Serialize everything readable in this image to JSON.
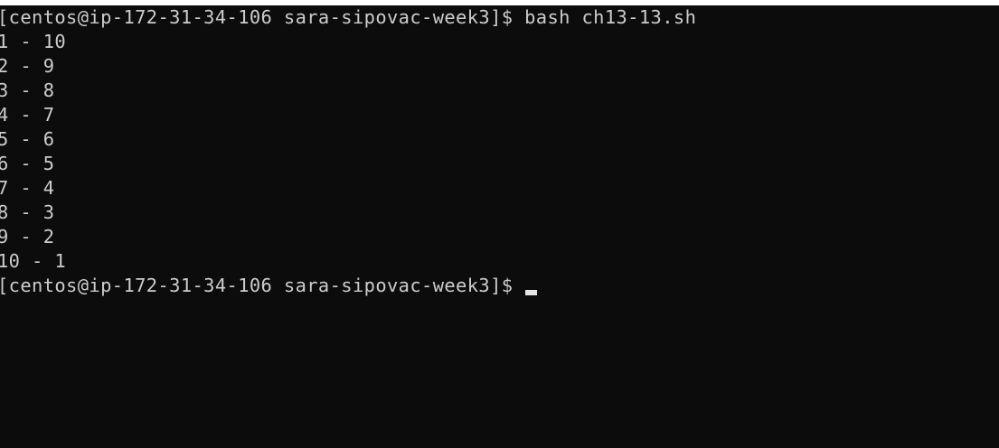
{
  "terminal": {
    "lines": [
      "[centos@ip-172-31-34-106 sara-sipovac-week3]$ bash ch13-13.sh",
      "1 - 10",
      "2 - 9",
      "3 - 8",
      "4 - 7",
      "5 - 6",
      "6 - 5",
      "7 - 4",
      "8 - 3",
      "9 - 2",
      "10 - 1"
    ],
    "prompt": "[centos@ip-172-31-34-106 sara-sipovac-week3]$ ",
    "colors": {
      "background": "#0c0c0c",
      "text": "#cccccc",
      "cursor": "#e6e6e6"
    }
  }
}
